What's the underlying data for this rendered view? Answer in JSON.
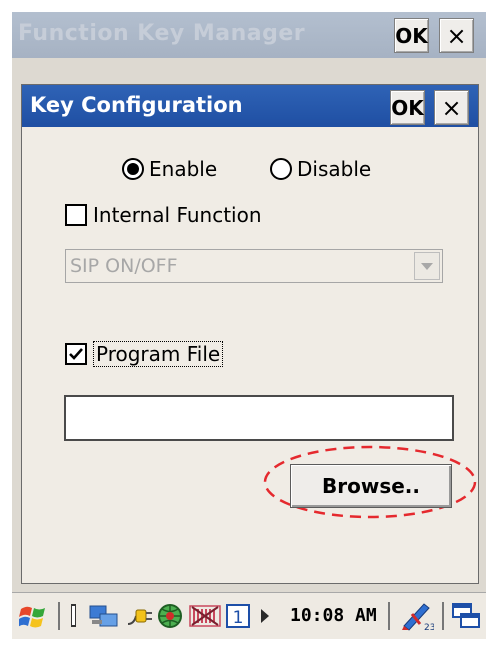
{
  "outer_window": {
    "title": "Function Key Manager",
    "ok_label": "OK",
    "close_label": "×"
  },
  "dialog": {
    "title": "Key Configuration",
    "ok_label": "OK",
    "close_label": "×",
    "enable_label": "Enable",
    "disable_label": "Disable",
    "enable_selected": true,
    "internal_function_label": "Internal Function",
    "internal_function_checked": false,
    "internal_function_value": "SIP ON/OFF",
    "program_file_label": "Program File",
    "program_file_checked": true,
    "program_file_value": "",
    "browse_label": "Browse.."
  },
  "taskbar": {
    "icons": [
      "start-flag-icon",
      "keyboard-icon",
      "network-icon",
      "power-plug-icon",
      "globe-icon",
      "wireless-icon",
      "input-number-icon",
      "arrow-icon",
      "sip-pen-icon",
      "desktop-icon"
    ],
    "input_indicator": "1",
    "time": "10:08 AM"
  },
  "colors": {
    "dialog_title": "#2558ac",
    "outer_title_inactive": "#aab6c7",
    "highlight_ellipse": "#e5292e"
  }
}
